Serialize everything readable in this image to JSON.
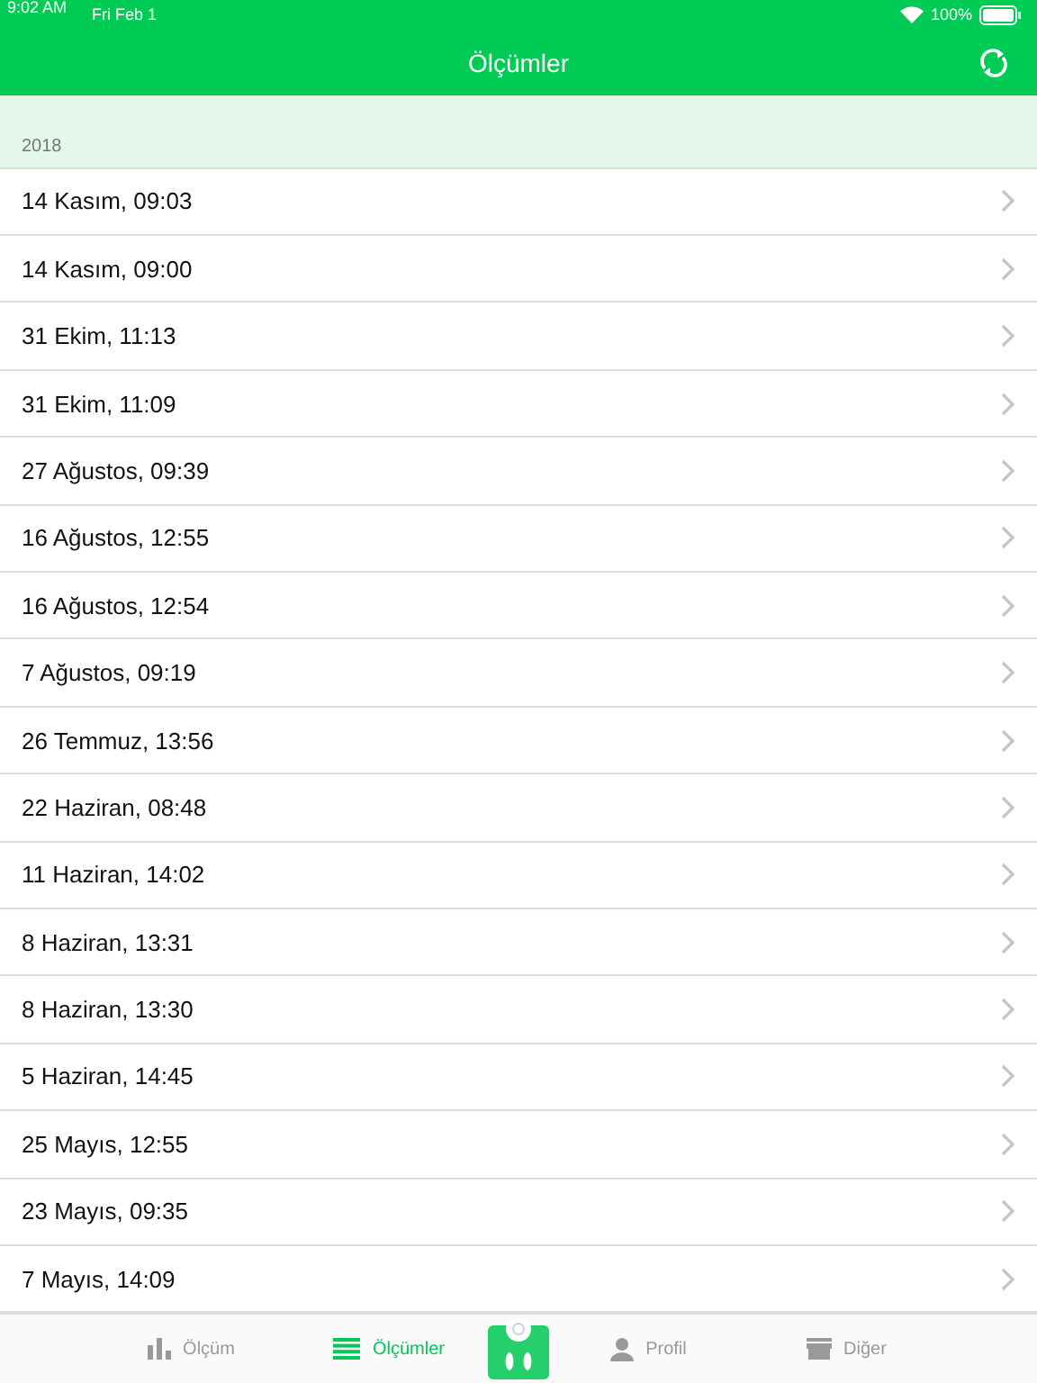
{
  "status_bar": {
    "time": "9:02 AM",
    "date": "Fri Feb 1",
    "battery": "100%"
  },
  "nav": {
    "title": "Ölçümler"
  },
  "section": {
    "header": "2018"
  },
  "rows": [
    {
      "label": "14 Kasım, 09:03"
    },
    {
      "label": "14 Kasım, 09:00"
    },
    {
      "label": "31 Ekim, 11:13"
    },
    {
      "label": "31 Ekim, 11:09"
    },
    {
      "label": "27 Ağustos, 09:39"
    },
    {
      "label": "16 Ağustos, 12:55"
    },
    {
      "label": "16 Ağustos, 12:54"
    },
    {
      "label": "7 Ağustos, 09:19"
    },
    {
      "label": "26 Temmuz, 13:56"
    },
    {
      "label": "22 Haziran, 08:48"
    },
    {
      "label": "11 Haziran, 14:02"
    },
    {
      "label": "8 Haziran, 13:31"
    },
    {
      "label": "8 Haziran, 13:30"
    },
    {
      "label": "5 Haziran, 14:45"
    },
    {
      "label": "25 Mayıs, 12:55"
    },
    {
      "label": "23 Mayıs, 09:35"
    },
    {
      "label": "7 Mayıs, 14:09"
    }
  ],
  "tab_bar": [
    {
      "kind": "chart",
      "label": "Ölçüm",
      "selected": false
    },
    {
      "kind": "list",
      "label": "Ölçümler",
      "selected": true
    },
    {
      "kind": "scale",
      "selected": false
    },
    {
      "kind": "person",
      "label": "Profil",
      "selected": false
    },
    {
      "kind": "store",
      "label": "Diğer",
      "selected": false
    }
  ]
}
